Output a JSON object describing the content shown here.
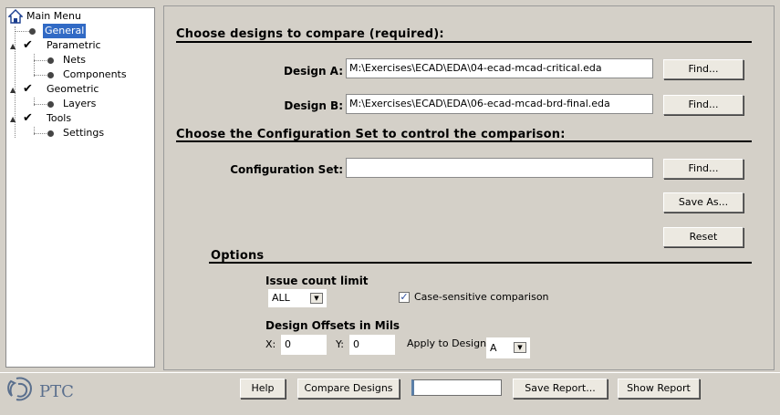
{
  "tree": {
    "root": "Main Menu",
    "general": "General",
    "parametric": "Parametric",
    "nets": "Nets",
    "components": "Components",
    "geometric": "Geometric",
    "layers": "Layers",
    "tools": "Tools",
    "settings": "Settings"
  },
  "compare": {
    "heading": "Choose designs to compare (required):",
    "design_a_label": "Design A:",
    "design_a_value": "M:\\Exercises\\ECAD\\EDA\\04-ecad-mcad-critical.eda",
    "design_b_label": "Design B:",
    "design_b_value": "M:\\Exercises\\ECAD\\EDA\\06-ecad-mcad-brd-final.eda",
    "find_label": "Find..."
  },
  "config": {
    "heading": "Choose the Configuration Set to control the comparison:",
    "label": "Configuration Set:",
    "value": "",
    "find_label": "Find...",
    "save_as_label": "Save As...",
    "reset_label": "Reset"
  },
  "options": {
    "heading": "Options",
    "issue_count_label": "Issue count limit",
    "issue_count_value": "ALL",
    "case_sensitive_label": "Case-sensitive comparison",
    "case_sensitive_checked": true,
    "offsets_label": "Design Offsets in Mils",
    "x_label": "X:",
    "x_value": "0",
    "y_label": "Y:",
    "y_value": "0",
    "apply_label": "Apply to Design:",
    "apply_value": "A"
  },
  "footer": {
    "logo_text": "PTC",
    "help_label": "Help",
    "compare_label": "Compare Designs",
    "save_report_label": "Save Report...",
    "show_report_label": "Show Report",
    "progress": 0
  },
  "colors": {
    "selection": "#316ac5",
    "background": "#d4d0c8",
    "logo": "#5a6f8d"
  },
  "icons": [
    "home-icon",
    "checkmark-icon",
    "tree-leaf-icon",
    "dropdown-arrow-icon",
    "ptc-logo-icon"
  ]
}
